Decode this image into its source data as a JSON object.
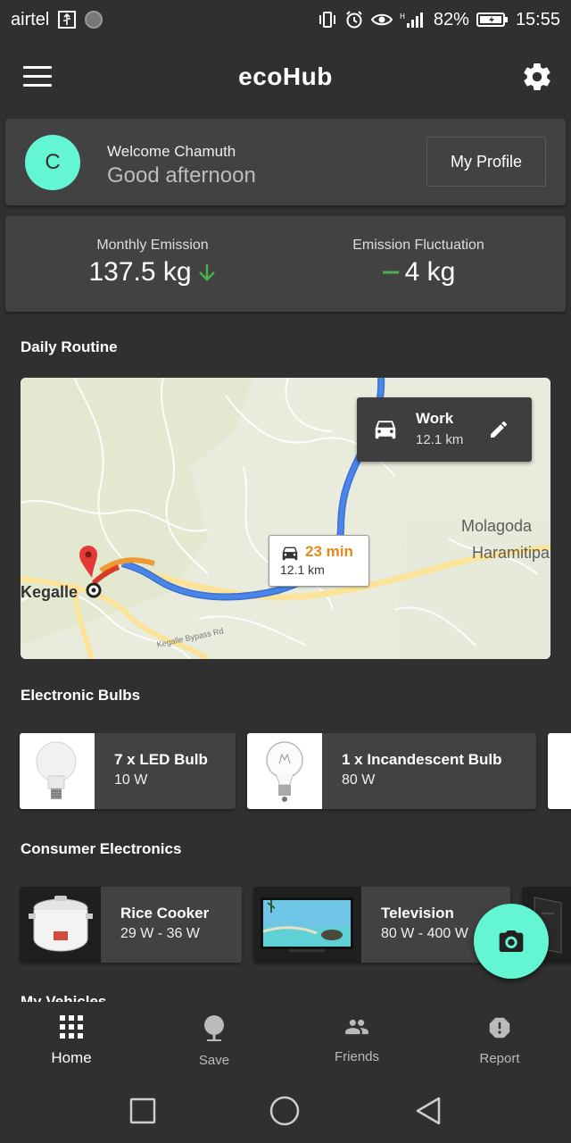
{
  "status_bar": {
    "carrier": "airtel",
    "battery": "82%",
    "time": "15:55"
  },
  "app": {
    "title": "ecoHub"
  },
  "welcome": {
    "avatar_letter": "C",
    "hello": "Welcome Chamuth",
    "greeting": "Good afternoon",
    "profile_button": "My Profile"
  },
  "emission": {
    "monthly_label": "Monthly Emission",
    "monthly_value": "137.5 kg",
    "fluct_label": "Emission Fluctuation",
    "fluct_value": "4 kg"
  },
  "daily_routine": {
    "title": "Daily Routine",
    "route": {
      "name": "Work",
      "distance": "12.1 km"
    },
    "bubble": {
      "time": "23 min",
      "distance": "12.1 km"
    },
    "map_labels": {
      "town": "Kegalle",
      "place1": "Molagoda",
      "place2": "Haramitipa",
      "road": "Kegalle Bypass Rd"
    }
  },
  "bulbs": {
    "title": "Electronic Bulbs",
    "items": [
      {
        "name": "7 x LED Bulb",
        "spec": "10 W"
      },
      {
        "name": "1 x Incandescent Bulb",
        "spec": "80 W"
      }
    ]
  },
  "electronics": {
    "title": "Consumer Electronics",
    "items": [
      {
        "name": "Rice Cooker",
        "spec": "29 W - 36 W"
      },
      {
        "name": "Television",
        "spec": "80 W - 400 W"
      }
    ]
  },
  "vehicles": {
    "title": "My Vehicles"
  },
  "bottom_nav": [
    {
      "label": "Home",
      "icon": "grid-icon"
    },
    {
      "label": "Save",
      "icon": "tree-icon"
    },
    {
      "label": "Friends",
      "icon": "people-icon"
    },
    {
      "label": "Report",
      "icon": "alert-icon"
    }
  ],
  "colors": {
    "accent": "#64f5d3",
    "background": "#303030",
    "card": "#424242",
    "positive": "#4caf50",
    "route": "#4a86e8"
  }
}
